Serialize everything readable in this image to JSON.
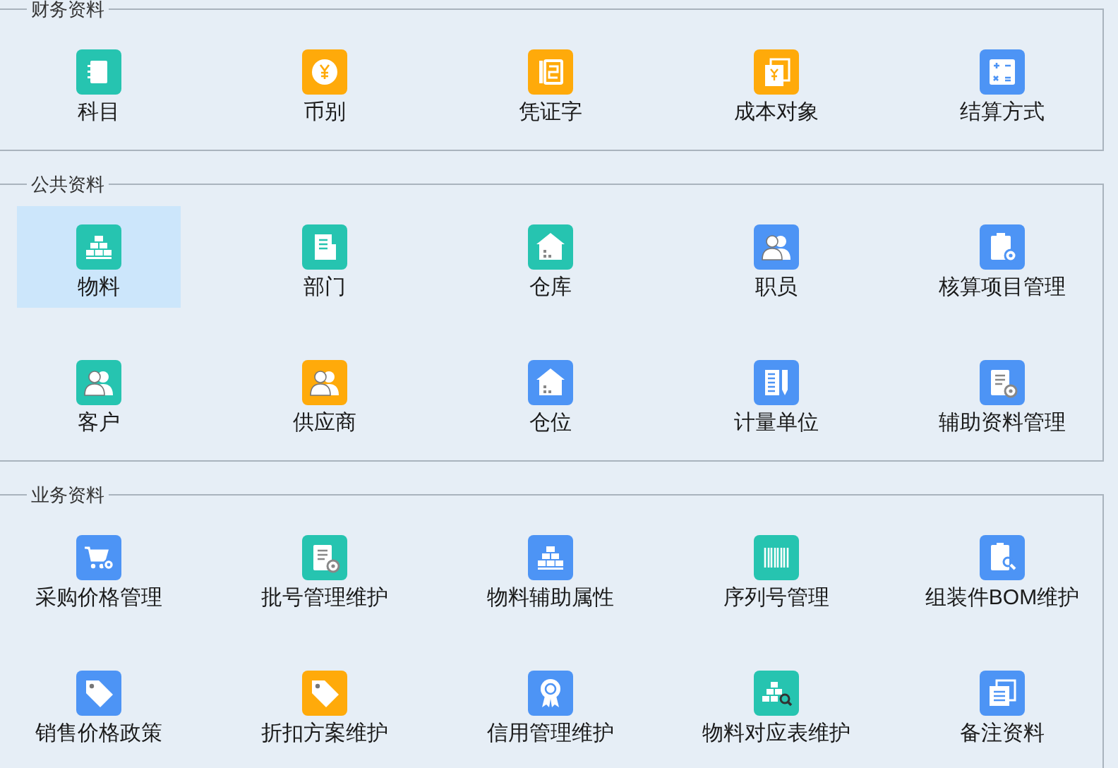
{
  "sections": [
    {
      "title": "财务资料",
      "items": [
        {
          "label": "科目",
          "kind": "notebook",
          "color": "#26c4b0",
          "selected": false
        },
        {
          "label": "币别",
          "kind": "coin",
          "color": "#ffaa0a",
          "selected": false
        },
        {
          "label": "凭证字",
          "kind": "ledger",
          "color": "#ffaa0a",
          "selected": false
        },
        {
          "label": "成本对象",
          "kind": "pages",
          "color": "#ffaa0a",
          "selected": false
        },
        {
          "label": "结算方式",
          "kind": "calculator",
          "color": "#4d94f5",
          "selected": false
        }
      ]
    },
    {
      "title": "公共资料",
      "items": [
        {
          "label": "物料",
          "kind": "bricks",
          "color": "#26c4b0",
          "selected": true
        },
        {
          "label": "部门",
          "kind": "building",
          "color": "#26c4b0",
          "selected": false
        },
        {
          "label": "仓库",
          "kind": "house",
          "color": "#26c4b0",
          "selected": false
        },
        {
          "label": "职员",
          "kind": "people",
          "color": "#4d94f5",
          "selected": false
        },
        {
          "label": "核算项目管理",
          "kind": "clipboard-gear",
          "color": "#4d94f5",
          "selected": false
        },
        {
          "label": "客户",
          "kind": "people",
          "color": "#26c4b0",
          "selected": false
        },
        {
          "label": "供应商",
          "kind": "people",
          "color": "#ffaa0a",
          "selected": false
        },
        {
          "label": "仓位",
          "kind": "house",
          "color": "#4d94f5",
          "selected": false
        },
        {
          "label": "计量单位",
          "kind": "ruler",
          "color": "#4d94f5",
          "selected": false
        },
        {
          "label": "辅助资料管理",
          "kind": "doc-gear",
          "color": "#4d94f5",
          "selected": false
        }
      ]
    },
    {
      "title": "业务资料",
      "items": [
        {
          "label": "采购价格管理",
          "kind": "cart-gear",
          "color": "#4d94f5",
          "selected": false
        },
        {
          "label": "批号管理维护",
          "kind": "doc-gear",
          "color": "#26c4b0",
          "selected": false
        },
        {
          "label": "物料辅助属性",
          "kind": "bricks",
          "color": "#4d94f5",
          "selected": false
        },
        {
          "label": "序列号管理",
          "kind": "barcode",
          "color": "#26c4b0",
          "selected": false
        },
        {
          "label": "组装件BOM维护",
          "kind": "doc-search",
          "color": "#4d94f5",
          "selected": false
        },
        {
          "label": "销售价格政策",
          "kind": "tag",
          "color": "#4d94f5",
          "selected": false
        },
        {
          "label": "折扣方案维护",
          "kind": "tag",
          "color": "#ffaa0a",
          "selected": false
        },
        {
          "label": "信用管理维护",
          "kind": "ribbon",
          "color": "#4d94f5",
          "selected": false
        },
        {
          "label": "物料对应表维护",
          "kind": "bricks-search",
          "color": "#26c4b0",
          "selected": false
        },
        {
          "label": "备注资料",
          "kind": "stack",
          "color": "#4d94f5",
          "selected": false
        }
      ]
    }
  ]
}
